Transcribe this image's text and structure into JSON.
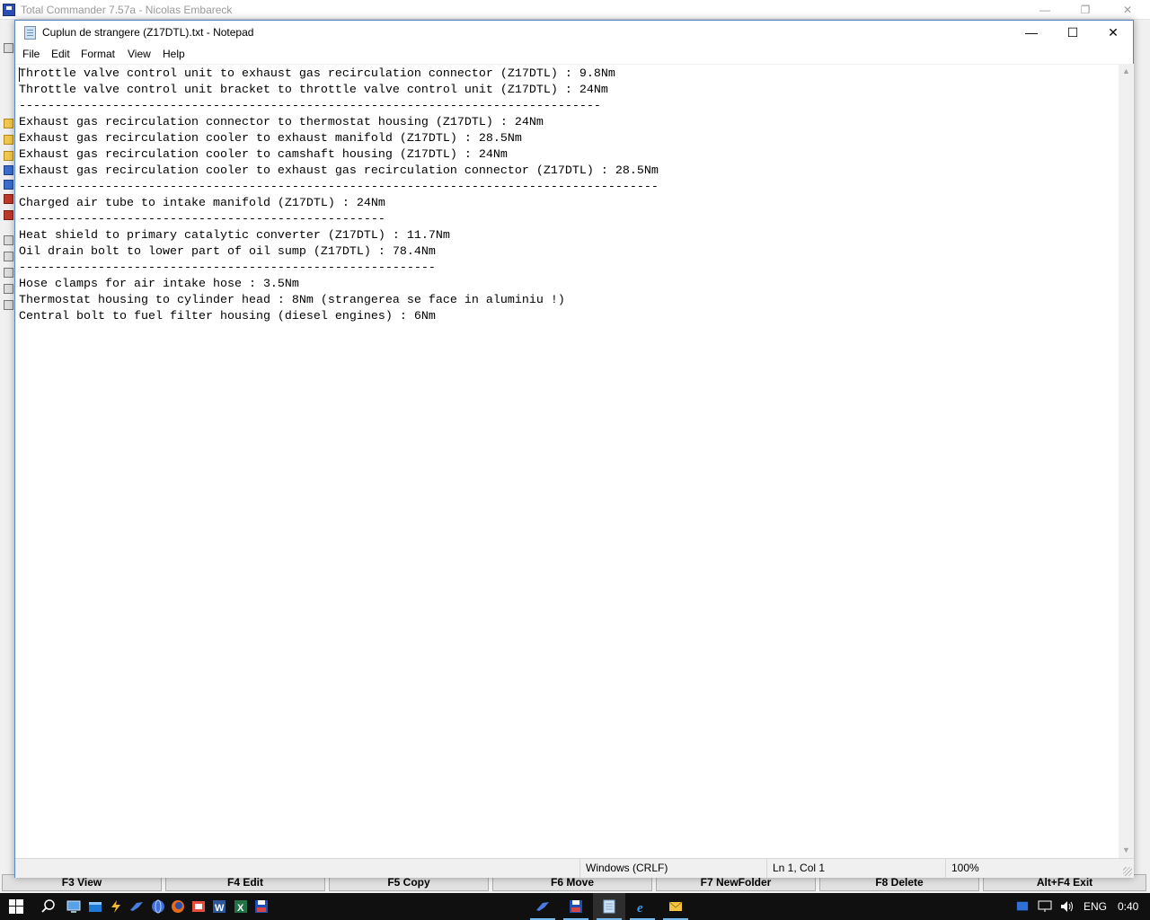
{
  "total_commander": {
    "title": "Total Commander 7.57a - Nicolas Embareck",
    "controls": {
      "minimize": "—",
      "restore": "❐",
      "close": "✕"
    },
    "function_keys": [
      "F3 View",
      "F4 Edit",
      "F5 Copy",
      "F6 Move",
      "F7 NewFolder",
      "F8 Delete",
      "Alt+F4 Exit"
    ]
  },
  "notepad": {
    "title": "Cuplun de strangere (Z17DTL).txt - Notepad",
    "controls": {
      "minimize": "—",
      "maximize": "☐",
      "close": "✕"
    },
    "menu": [
      "File",
      "Edit",
      "Format",
      "View",
      "Help"
    ],
    "text": "Throttle valve control unit to exhaust gas recirculation connector (Z17DTL) : 9.8Nm\nThrottle valve control unit bracket to throttle valve control unit (Z17DTL) : 24Nm\n---------------------------------------------------------------------------------\nExhaust gas recirculation connector to thermostat housing (Z17DTL) : 24Nm\nExhaust gas recirculation cooler to exhaust manifold (Z17DTL) : 28.5Nm\nExhaust gas recirculation cooler to camshaft housing (Z17DTL) : 24Nm\nExhaust gas recirculation cooler to exhaust gas recirculation connector (Z17DTL) : 28.5Nm\n-----------------------------------------------------------------------------------------\nCharged air tube to intake manifold (Z17DTL) : 24Nm\n---------------------------------------------------\nHeat shield to primary catalytic converter (Z17DTL) : 11.7Nm\nOil drain bolt to lower part of oil sump (Z17DTL) : 78.4Nm\n----------------------------------------------------------\nHose clamps for air intake hose : 3.5Nm\nThermostat housing to cylinder head : 8Nm (strangerea se face in aluminiu !)\nCentral bolt to fuel filter housing (diesel engines) : 6Nm",
    "status": {
      "line_endings": "Windows (CRLF)",
      "position": "Ln 1, Col 1",
      "zoom": "100%"
    },
    "scroll": {
      "up": "▲",
      "down": "▼"
    }
  },
  "taskbar": {
    "apps": [
      "start",
      "search",
      "task-view",
      "explorer",
      "winamp",
      "chrome",
      "firefox",
      "snipping",
      "word",
      "excel",
      "total-commander-floppy",
      "bird-app",
      "floppy-app",
      "notepad",
      "internet-explorer",
      "mail"
    ],
    "tray": {
      "language": "ENG",
      "clock": "0:40"
    },
    "colors": {
      "bar": "#101010",
      "active_indicator": "#76b9ed"
    }
  },
  "colors": {
    "window_border": "#5a86c6",
    "editor_bg": "#ffffff",
    "chrome_bg": "#f0f0f0"
  }
}
